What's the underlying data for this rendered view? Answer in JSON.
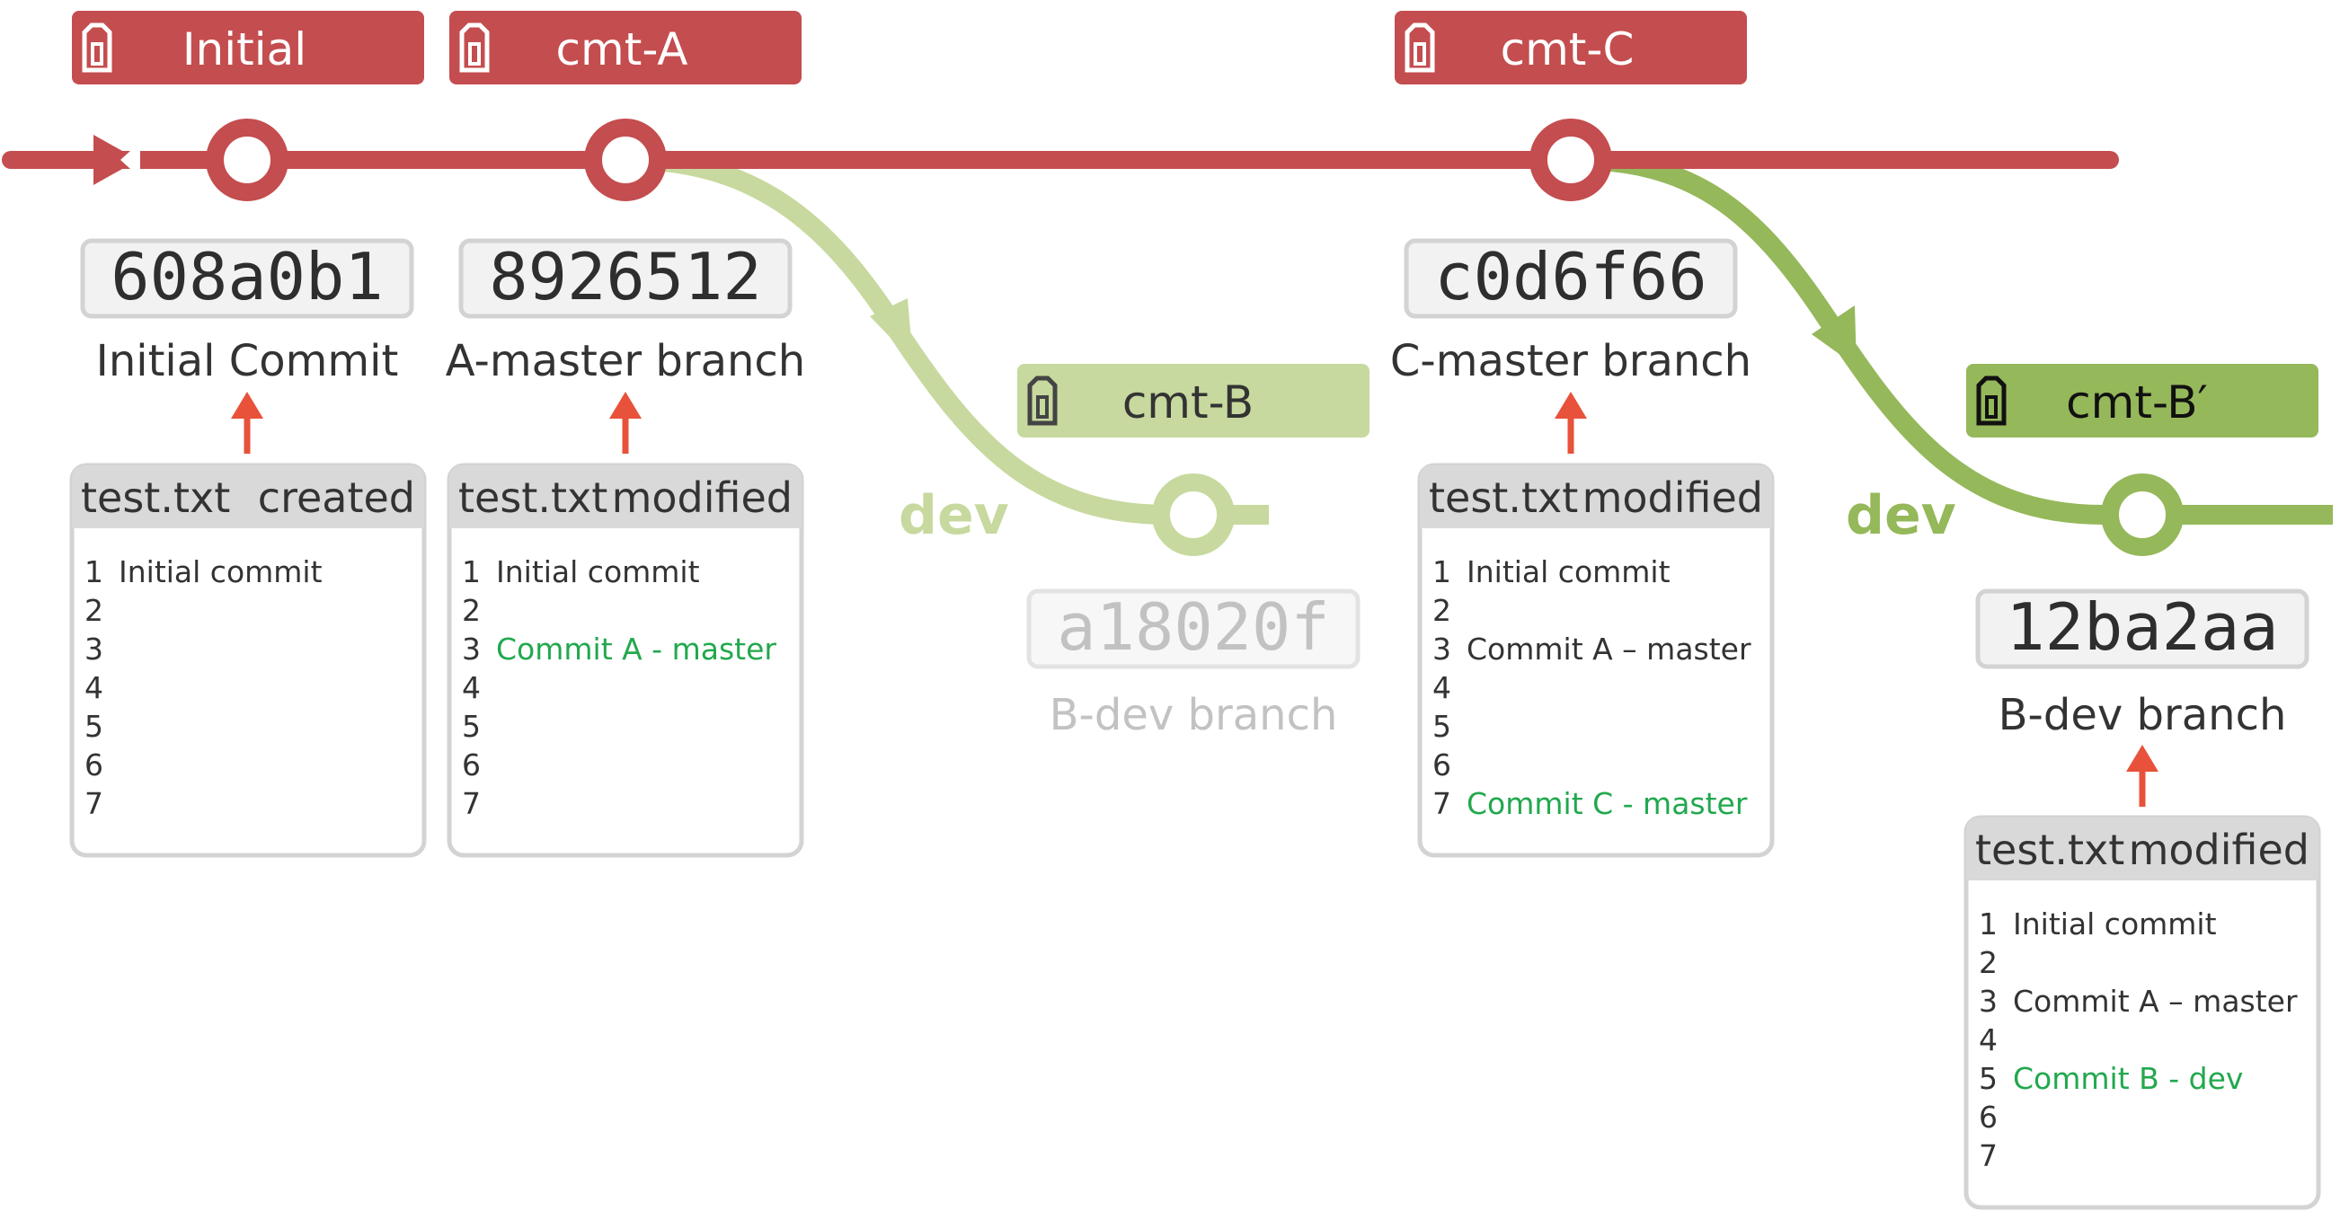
{
  "colors": {
    "master": "#c44d4f",
    "dev_light": "#c7d99e",
    "dev_dark": "#95b85a",
    "arrow": "#e8523a",
    "hash_bg": "#f2f2f2",
    "hash_border": "#d3d3d3",
    "file_header": "#d9d9d9",
    "file_border": "#d3d3d3",
    "added_text": "#22a84e",
    "faded_text": "#c2c2c2",
    "text": "#333333"
  },
  "icons": {
    "tag": "tag-icon"
  },
  "tags": {
    "initial": "Initial",
    "cmt_a": "cmt-A",
    "cmt_b": "cmt-B",
    "cmt_c": "cmt-C",
    "cmt_b2": "cmt-B′"
  },
  "branch_labels": {
    "dev_1": "dev",
    "dev_2": "dev"
  },
  "commits": {
    "initial": {
      "hash": "608a0b1",
      "description": "Initial Commit"
    },
    "a": {
      "hash": "8926512",
      "description": "A-master branch"
    },
    "b": {
      "hash": "a18020f",
      "description": "B-dev branch"
    },
    "c": {
      "hash": "c0d6f66",
      "description": "C-master branch"
    },
    "b2": {
      "hash": "12ba2aa",
      "description": "B-dev branch"
    }
  },
  "files": {
    "initial": {
      "name": "test.txt",
      "status": "created",
      "lines": [
        {
          "num": "1",
          "text": "Initial commit"
        },
        {
          "num": "2",
          "text": ""
        },
        {
          "num": "3",
          "text": ""
        },
        {
          "num": "4",
          "text": ""
        },
        {
          "num": "5",
          "text": ""
        },
        {
          "num": "6",
          "text": ""
        },
        {
          "num": "7",
          "text": ""
        }
      ]
    },
    "a": {
      "name": "test.txt",
      "status": "modified",
      "lines": [
        {
          "num": "1",
          "text": "Initial commit"
        },
        {
          "num": "2",
          "text": ""
        },
        {
          "num": "3",
          "text": "Commit A - master",
          "added": true
        },
        {
          "num": "4",
          "text": ""
        },
        {
          "num": "5",
          "text": ""
        },
        {
          "num": "6",
          "text": ""
        },
        {
          "num": "7",
          "text": ""
        }
      ]
    },
    "c": {
      "name": "test.txt",
      "status": "modified",
      "lines": [
        {
          "num": "1",
          "text": "Initial commit"
        },
        {
          "num": "2",
          "text": ""
        },
        {
          "num": "3",
          "text": "Commit A – master"
        },
        {
          "num": "4",
          "text": ""
        },
        {
          "num": "5",
          "text": ""
        },
        {
          "num": "6",
          "text": ""
        },
        {
          "num": "7",
          "text": "Commit C - master",
          "added": true
        }
      ]
    },
    "b2": {
      "name": "test.txt",
      "status": "modified",
      "lines": [
        {
          "num": "1",
          "text": "Initial commit"
        },
        {
          "num": "2",
          "text": ""
        },
        {
          "num": "3",
          "text": "Commit A – master"
        },
        {
          "num": "4",
          "text": ""
        },
        {
          "num": "5",
          "text": "Commit B - dev",
          "added": true
        },
        {
          "num": "6",
          "text": ""
        },
        {
          "num": "7",
          "text": ""
        }
      ]
    }
  }
}
